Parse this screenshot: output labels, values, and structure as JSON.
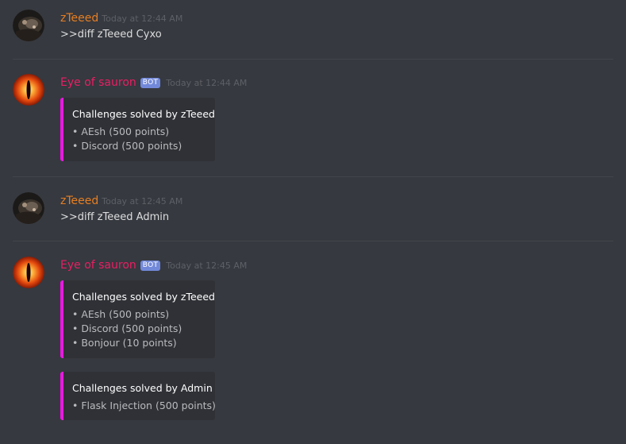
{
  "colors": {
    "background": "#36393f",
    "user_color": "#e67e22",
    "bot_color": "#e91e63",
    "embed_accent": "#e81ae0",
    "bot_tag": "#7289da"
  },
  "messages": [
    {
      "author": "zTeeed",
      "timestamp": "Today at 12:44 AM",
      "avatar_icon": "ztzeed-avatar-icon",
      "text": ">>diff zTeeed Cyxo"
    },
    {
      "author": "Eye of sauron",
      "bot_tag": "BOT",
      "timestamp": "Today at 12:44 AM",
      "avatar_icon": "eye-of-sauron-avatar-icon",
      "embeds": [
        {
          "title": "Challenges solved by zTeeed",
          "lines": [
            "• AEsh (500 points)",
            "• Discord (500 points)"
          ]
        }
      ]
    },
    {
      "author": "zTeeed",
      "timestamp": "Today at 12:45 AM",
      "avatar_icon": "ztzeed-avatar-icon",
      "text": ">>diff zTeeed Admin"
    },
    {
      "author": "Eye of sauron",
      "bot_tag": "BOT",
      "timestamp": "Today at 12:45 AM",
      "avatar_icon": "eye-of-sauron-avatar-icon",
      "embeds": [
        {
          "title": "Challenges solved by zTeeed",
          "lines": [
            "• AEsh (500 points)",
            "• Discord (500 points)",
            "• Bonjour (10 points)"
          ]
        },
        {
          "title": "Challenges solved by Admin",
          "lines": [
            "• Flask Injection (500 points)"
          ]
        }
      ]
    }
  ]
}
